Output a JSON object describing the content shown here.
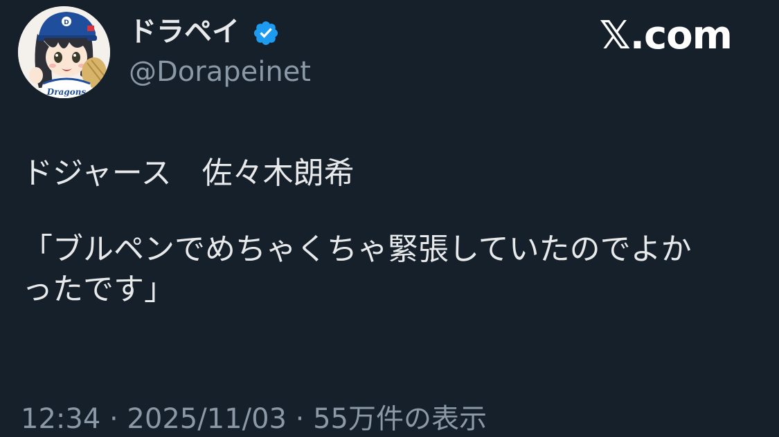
{
  "author": {
    "display_name": "ドラペイ",
    "handle": "@Dorapeinet",
    "verified": true,
    "avatar_icon": "dragons-fan-avatar"
  },
  "brand": {
    "label": "𝕏.com"
  },
  "tweet": {
    "line1": "ドジャース　佐々木朗希",
    "line2": "「ブルペンでめちゃくちゃ緊張していたのでよか",
    "line3": "ったです」"
  },
  "footer": {
    "meta": "12:34 · 2025/11/03 · 55万件の表示"
  },
  "colors": {
    "background": "#16202b",
    "text": "#e7e9ea",
    "muted": "#8b98a5",
    "verified": "#1d9bf0"
  }
}
